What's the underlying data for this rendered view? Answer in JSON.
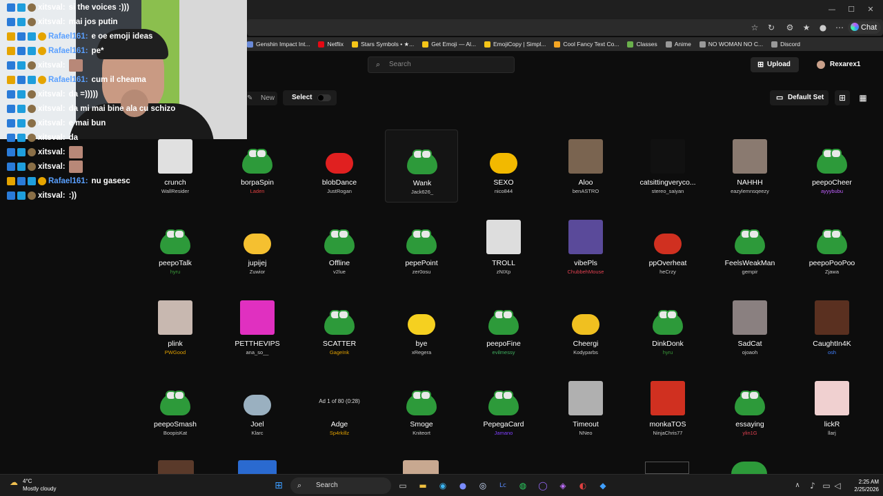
{
  "browser": {
    "window_controls": [
      "—",
      "☐",
      "✕"
    ],
    "chat_label": "Chat",
    "bookmarks": [
      {
        "label": "Genshin Impact Int...",
        "color": "#6a8ad8"
      },
      {
        "label": "Netflix",
        "color": "#e50914"
      },
      {
        "label": "Stars Symbols • ★...",
        "color": "#f5c518"
      },
      {
        "label": "Get Emoji — Al...",
        "color": "#f5c518"
      },
      {
        "label": "EmojiCopy | Simpl...",
        "color": "#f5c518"
      },
      {
        "label": "Cool Fancy Text Co...",
        "color": "#f5a623"
      },
      {
        "label": "Classes",
        "color": "#6ab04c"
      },
      {
        "label": "Anime",
        "color": "#999999"
      },
      {
        "label": "NO WOMAN NO C...",
        "color": "#999999"
      },
      {
        "label": "Discord",
        "color": "#999999"
      }
    ]
  },
  "header": {
    "search_placeholder": "Search",
    "upload_label": "Upload",
    "username": "Rexarex1",
    "new_label": "New",
    "select_label": "Select",
    "set_label": "Default Set"
  },
  "emotes": [
    {
      "name": "crunch",
      "author": "WallResider",
      "author_color": "#cccccc",
      "art": "sq",
      "color": "#e0e0e0"
    },
    {
      "name": "borpaSpin",
      "author": "Laden",
      "author_color": "#e04040",
      "art": "frog",
      "color": "#2d9a3a"
    },
    {
      "name": "blobDance",
      "author": "JustRogan",
      "author_color": "#cccccc",
      "art": "blob",
      "color": "#e02020"
    },
    {
      "name": "Wank",
      "author": "Jack626_",
      "author_color": "#cccccc",
      "art": "frog",
      "color": "#2d9a3a",
      "highlight": true
    },
    {
      "name": "SEXO",
      "author": "nico844",
      "author_color": "#cccccc",
      "art": "blob",
      "color": "#f2b900"
    },
    {
      "name": "Aloo",
      "author": "benASTRO",
      "author_color": "#cccccc",
      "art": "sq",
      "color": "#7a6450"
    },
    {
      "name": "catsittingveryco...",
      "author": "stereo_saiyan",
      "author_color": "#cccccc",
      "art": "sq",
      "color": "#111111"
    },
    {
      "name": "NAHHH",
      "author": "eazylemnsqeezy",
      "author_color": "#cccccc",
      "art": "sq",
      "color": "#8a7a70"
    },
    {
      "name": "peepoCheer",
      "author": "ayyybubu",
      "author_color": "#c060ff",
      "art": "frog",
      "color": "#2d9a3a"
    },
    {
      "name": "peepoTalk",
      "author": "hyru",
      "author_color": "#3a9a3a",
      "art": "frog",
      "color": "#2d9a3a"
    },
    {
      "name": "jupijej",
      "author": "Zuwior",
      "author_color": "#cccccc",
      "art": "blob",
      "color": "#f5c030"
    },
    {
      "name": "Offline",
      "author": "v2lue",
      "author_color": "#cccccc",
      "art": "frog",
      "color": "#2d9a3a"
    },
    {
      "name": "pepePoint",
      "author": "zer0osu",
      "author_color": "#cccccc",
      "art": "frog",
      "color": "#2d9a3a"
    },
    {
      "name": "TROLL",
      "author": "zNIXp",
      "author_color": "#cccccc",
      "art": "sq",
      "color": "#dddddd"
    },
    {
      "name": "vibePls",
      "author": "ChubbehMouse",
      "author_color": "#e04050",
      "art": "sq",
      "color": "#5a4a9a"
    },
    {
      "name": "ppOverheat",
      "author": "heCrzy",
      "author_color": "#cccccc",
      "art": "blob",
      "color": "#d03020"
    },
    {
      "name": "FeelsWeakMan",
      "author": "gempir",
      "author_color": "#cccccc",
      "art": "frog",
      "color": "#2d9a3a"
    },
    {
      "name": "peepoPooPoo",
      "author": "Zjawa",
      "author_color": "#cccccc",
      "art": "frog",
      "color": "#2d9a3a"
    },
    {
      "name": "plink",
      "author": "PWGood",
      "author_color": "#e0a000",
      "art": "sq",
      "color": "#c8b8b0"
    },
    {
      "name": "PETTHEVIPS",
      "author": "ana_so__",
      "author_color": "#cccccc",
      "art": "sq",
      "color": "#e030c0"
    },
    {
      "name": "SCATTER",
      "author": "GageInk",
      "author_color": "#e0a000",
      "art": "frog",
      "color": "#2d9a3a"
    },
    {
      "name": "bye",
      "author": "xRegera",
      "author_color": "#cccccc",
      "art": "blob",
      "color": "#f5d020"
    },
    {
      "name": "peepoFine",
      "author": "evilmessy",
      "author_color": "#40b060",
      "art": "frog",
      "color": "#2d9a3a"
    },
    {
      "name": "Cheergi",
      "author": "Kodyparbs",
      "author_color": "#cccccc",
      "art": "blob",
      "color": "#f0c020"
    },
    {
      "name": "DinkDonk",
      "author": "hyru",
      "author_color": "#3a9a3a",
      "art": "frog",
      "color": "#2d9a3a"
    },
    {
      "name": "SadCat",
      "author": "ojoaoh",
      "author_color": "#cccccc",
      "art": "sq",
      "color": "#8a8080"
    },
    {
      "name": "CaughtIn4K",
      "author": "osh",
      "author_color": "#4080ff",
      "art": "sq",
      "color": "#5a3020"
    },
    {
      "name": "peepoSmash",
      "author": "BoopisKat",
      "author_color": "#cccccc",
      "art": "frog",
      "color": "#2d9a3a"
    },
    {
      "name": "Joel",
      "author": "Klarc",
      "author_color": "#cccccc",
      "art": "blob",
      "color": "#9ab0c0"
    },
    {
      "name": "Adge",
      "author": "Sp4rkillz",
      "author_color": "#e0a000",
      "art": "ad",
      "color": "#111111",
      "ad_text": "Ad 1 of 80 (0:28)"
    },
    {
      "name": "Smoge",
      "author": "Kniteort",
      "author_color": "#cccccc",
      "art": "frog",
      "color": "#2d9a3a"
    },
    {
      "name": "PepegaCard",
      "author": "Jamano",
      "author_color": "#8040ff",
      "art": "frog",
      "color": "#2d9a3a"
    },
    {
      "name": "Timeout",
      "author": "NNeo",
      "author_color": "#cccccc",
      "art": "sq",
      "color": "#b0b0b0"
    },
    {
      "name": "monkaTOS",
      "author": "NinjaChris77",
      "author_color": "#cccccc",
      "art": "sq",
      "color": "#d03020"
    },
    {
      "name": "essaying",
      "author": "ylin1G",
      "author_color": "#e04050",
      "art": "frog",
      "color": "#2d9a3a"
    },
    {
      "name": "lickR",
      "author": "llarj",
      "author_color": "#cccccc",
      "art": "sq",
      "color": "#f0d0d0"
    }
  ],
  "chat": [
    {
      "user": "xitsval:",
      "text": "si the voices :)))",
      "user_color": "#ffffff",
      "badge_count": 3
    },
    {
      "user": "xitsval:",
      "text": "mai jos putin",
      "user_color": "#ffffff",
      "badge_count": 3
    },
    {
      "user": "Rafael161:",
      "text": "e oe emoji ideas",
      "user_color": "#5aa0ff",
      "badge_count": 4
    },
    {
      "user": "Rafael161:",
      "text": "pe*",
      "user_color": "#5aa0ff",
      "badge_count": 4
    },
    {
      "user": "xitsval:",
      "text": "",
      "user_color": "#ffffff",
      "badge_count": 3,
      "emote": true
    },
    {
      "user": "Rafael161:",
      "text": "cum il cheama",
      "user_color": "#5aa0ff",
      "badge_count": 4
    },
    {
      "user": "xitsval:",
      "text": "da =)))))",
      "user_color": "#ffffff",
      "badge_count": 3
    },
    {
      "user": "xitsval:",
      "text": "da mi mai bine ala cu schizo",
      "user_color": "#ffffff",
      "badge_count": 3
    },
    {
      "user": "xitsval:",
      "text": "e mai bun",
      "user_color": "#ffffff",
      "badge_count": 3
    },
    {
      "user": "xitsval:",
      "text": "da",
      "user_color": "#ffffff",
      "badge_count": 3
    },
    {
      "user": "xitsval:",
      "text": "",
      "user_color": "#ffffff",
      "badge_count": 3,
      "emote": true
    },
    {
      "user": "xitsval:",
      "text": "",
      "user_color": "#ffffff",
      "badge_count": 3,
      "emote": true
    },
    {
      "user": "Rafael161:",
      "text": "nu gasesc",
      "user_color": "#5aa0ff",
      "badge_count": 4
    },
    {
      "user": "xitsval:",
      "text": ":))",
      "user_color": "#ffffff",
      "badge_count": 3
    }
  ],
  "taskbar": {
    "weather_temp": "4°C",
    "weather_desc": "Mostly cloudy",
    "search_label": "Search",
    "time": "2:25 AM",
    "date": "2/25/2026"
  }
}
